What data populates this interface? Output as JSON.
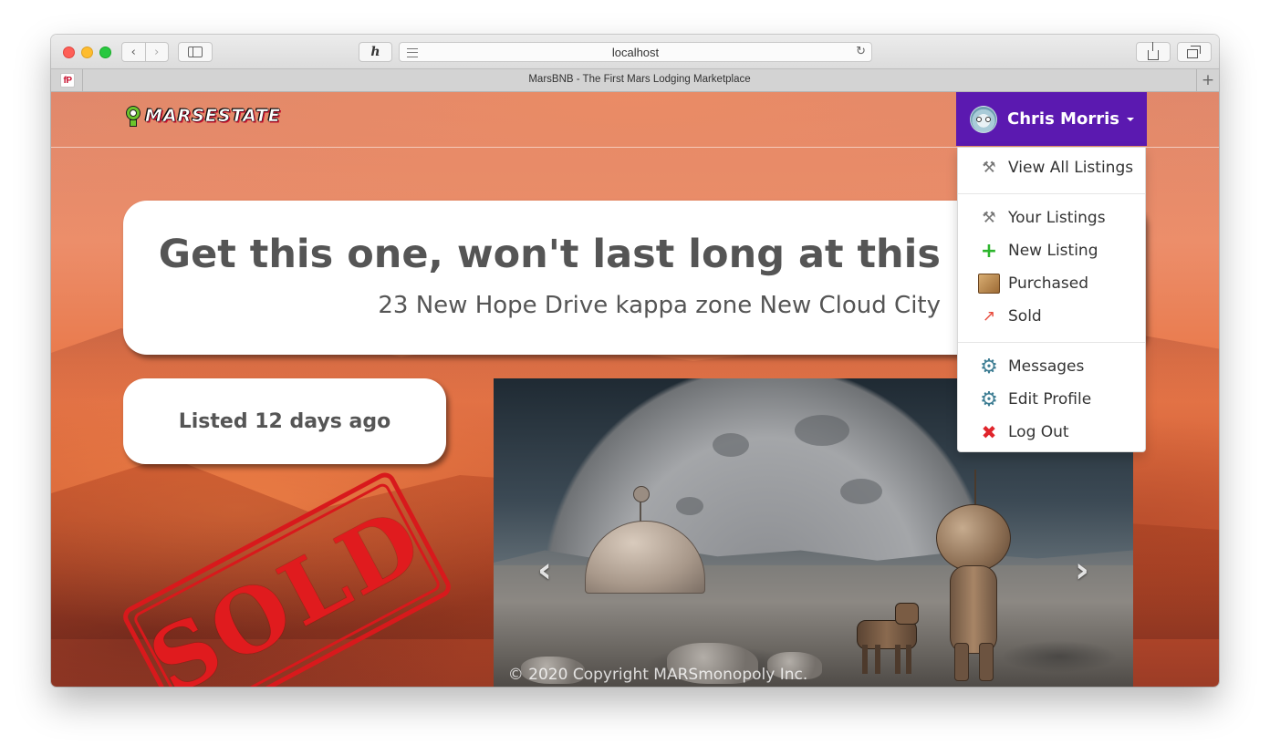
{
  "browser": {
    "url": "localhost",
    "tab_title": "MarsBNB - The First Mars Lodging Marketplace",
    "favicon_text": "fP",
    "new_tab_label": "+",
    "reload_label": "↻"
  },
  "navbar": {
    "logo_text": "MARSESTATE",
    "user_name": "Chris Morris"
  },
  "user_menu": {
    "groups": [
      [
        {
          "label": "View All Listings",
          "icon": "tools-icon"
        }
      ],
      [
        {
          "label": "Your Listings",
          "icon": "tools-icon"
        },
        {
          "label": "New Listing",
          "icon": "plus-icon"
        },
        {
          "label": "Purchased",
          "icon": "box-icon"
        },
        {
          "label": "Sold",
          "icon": "rocket-icon"
        }
      ],
      [
        {
          "label": "Messages",
          "icon": "gear-icon"
        },
        {
          "label": "Edit Profile",
          "icon": "gear-icon"
        },
        {
          "label": "Log Out",
          "icon": "x-icon"
        }
      ]
    ]
  },
  "listing": {
    "headline": "Get this one, won't last long at this",
    "address": "23 New Hope Drive kappa zone New Cloud City",
    "listed": "Listed 12 days ago",
    "status_stamp": "SOLD"
  },
  "carousel": {
    "prev_label": "‹",
    "next_label": "›"
  },
  "footer": {
    "copyright": "© 2020 Copyright MARSmonopoly Inc."
  },
  "colors": {
    "menu_accent": "#5b19b0",
    "stamp_red": "#d8191c"
  }
}
